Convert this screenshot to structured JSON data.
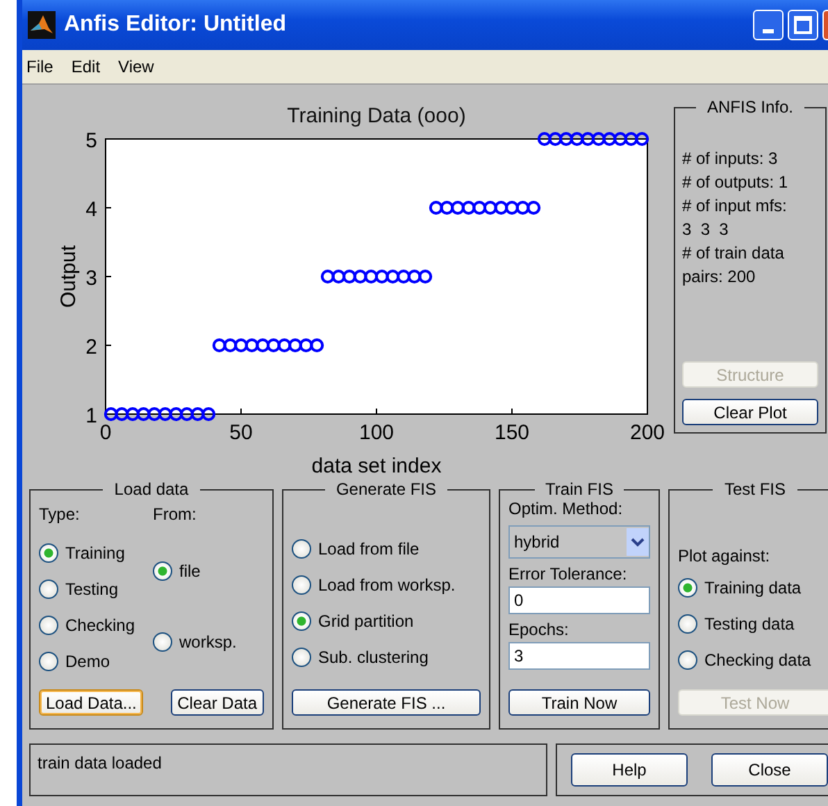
{
  "window": {
    "title": "Anfis Editor: Untitled"
  },
  "menu": [
    "File",
    "Edit",
    "View"
  ],
  "plot": {
    "chart_data": {
      "type": "scatter",
      "title": "Training Data (ooo)",
      "xlabel": "data set index",
      "ylabel": "Output",
      "x": [
        2,
        6,
        10,
        14,
        18,
        22,
        26,
        30,
        34,
        38,
        42,
        46,
        50,
        54,
        58,
        62,
        66,
        70,
        74,
        78,
        82,
        86,
        90,
        94,
        98,
        102,
        106,
        110,
        114,
        118,
        122,
        126,
        130,
        134,
        138,
        142,
        146,
        150,
        154,
        158,
        162,
        166,
        170,
        174,
        178,
        182,
        186,
        190,
        194,
        198
      ],
      "series": [
        {
          "color": "#0000ff",
          "values": [
            1,
            1,
            1,
            1,
            1,
            1,
            1,
            1,
            1,
            1,
            2,
            2,
            2,
            2,
            2,
            2,
            2,
            2,
            2,
            2,
            3,
            3,
            3,
            3,
            3,
            3,
            3,
            3,
            3,
            3,
            4,
            4,
            4,
            4,
            4,
            4,
            4,
            4,
            4,
            4,
            5,
            5,
            5,
            5,
            5,
            5,
            5,
            5,
            5,
            5
          ]
        }
      ],
      "xlim": [
        0,
        200
      ],
      "ylim": [
        1,
        5
      ],
      "xticks": [
        0,
        50,
        100,
        150,
        200
      ],
      "yticks": [
        1,
        2,
        3,
        4,
        5
      ]
    }
  },
  "anfis_info": {
    "title": "ANFIS Info.",
    "lines": [
      "# of inputs: 3",
      "# of outputs: 1",
      "# of input mfs:",
      "3  3  3",
      "# of train data",
      "pairs: 200"
    ],
    "buttons": [
      {
        "label": "Structure",
        "disabled": true
      },
      {
        "label": "Clear Plot",
        "disabled": false
      }
    ]
  },
  "load_data": {
    "title": "Load data",
    "type_label": "Type:",
    "from_label": "From:",
    "types": [
      {
        "label": "Training",
        "selected": true
      },
      {
        "label": "Testing",
        "selected": false
      },
      {
        "label": "Checking",
        "selected": false
      },
      {
        "label": "Demo",
        "selected": false
      }
    ],
    "sources": [
      {
        "label": "file",
        "selected": true
      },
      {
        "label": "worksp.",
        "selected": false
      }
    ],
    "buttons": [
      {
        "label": "Load Data...",
        "focused": true
      },
      {
        "label": "Clear Data",
        "focused": false
      }
    ]
  },
  "generate_fis": {
    "title": "Generate FIS",
    "options": [
      {
        "label": "Load from file",
        "selected": false
      },
      {
        "label": "Load from worksp.",
        "selected": false
      },
      {
        "label": "Grid partition",
        "selected": true
      },
      {
        "label": "Sub. clustering",
        "selected": false
      }
    ],
    "button": "Generate FIS ..."
  },
  "train_fis": {
    "title": "Train FIS",
    "method_label": "Optim. Method:",
    "method": "hybrid",
    "tolerance_label": "Error Tolerance:",
    "tolerance": "0",
    "epochs_label": "Epochs:",
    "epochs": "3",
    "button": "Train Now"
  },
  "test_fis": {
    "title": "Test FIS",
    "plot_against_label": "Plot against:",
    "options": [
      {
        "label": "Training data",
        "selected": true
      },
      {
        "label": "Testing data",
        "selected": false
      },
      {
        "label": "Checking data",
        "selected": false
      }
    ],
    "button": {
      "label": "Test Now",
      "disabled": true
    }
  },
  "status": "train data loaded",
  "buttons": [
    "Help",
    "Close"
  ]
}
